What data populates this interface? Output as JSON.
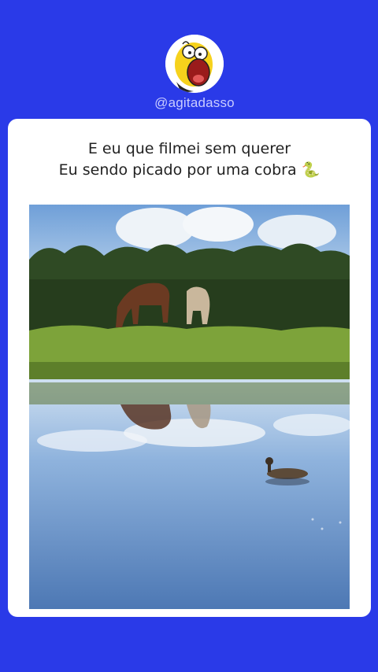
{
  "profile": {
    "handle": "@agitadasso",
    "avatar_icon": "homer-simpson-screaming-icon"
  },
  "post": {
    "caption_line1": "E eu que filmei sem querer",
    "caption_line2": "Eu sendo picado por uma cobra 🐍",
    "media_icon": "video-still-horses-duck-lake"
  },
  "colors": {
    "background": "#2a3ae8",
    "card": "#ffffff",
    "handle_text": "#c9ccff"
  }
}
